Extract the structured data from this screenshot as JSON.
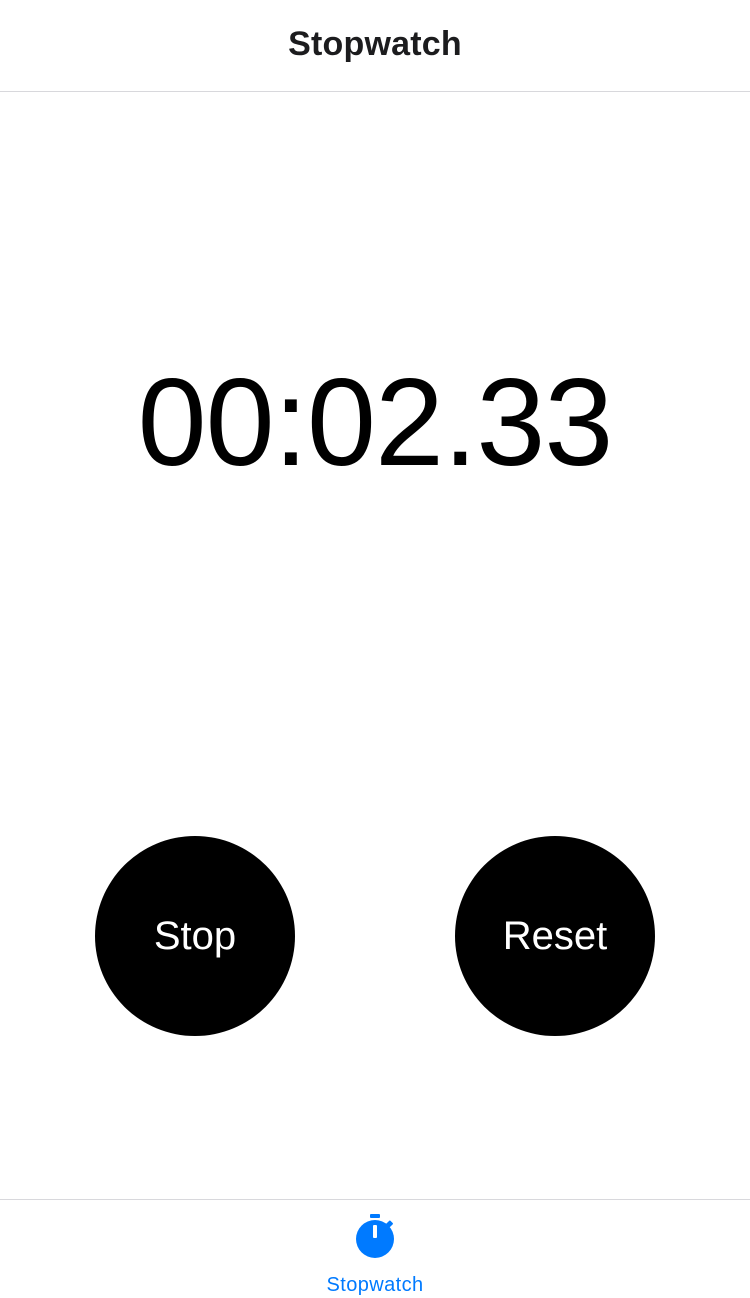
{
  "header": {
    "title": "Stopwatch"
  },
  "stopwatch": {
    "elapsed_time": "00:02.33"
  },
  "buttons": {
    "stop_label": "Stop",
    "reset_label": "Reset"
  },
  "tab_bar": {
    "items": [
      {
        "label": "Stopwatch",
        "icon": "stopwatch-icon",
        "selected": true
      }
    ]
  },
  "colors": {
    "accent": "#007AFF",
    "button_bg": "#000000",
    "button_text": "#FFFFFF"
  }
}
